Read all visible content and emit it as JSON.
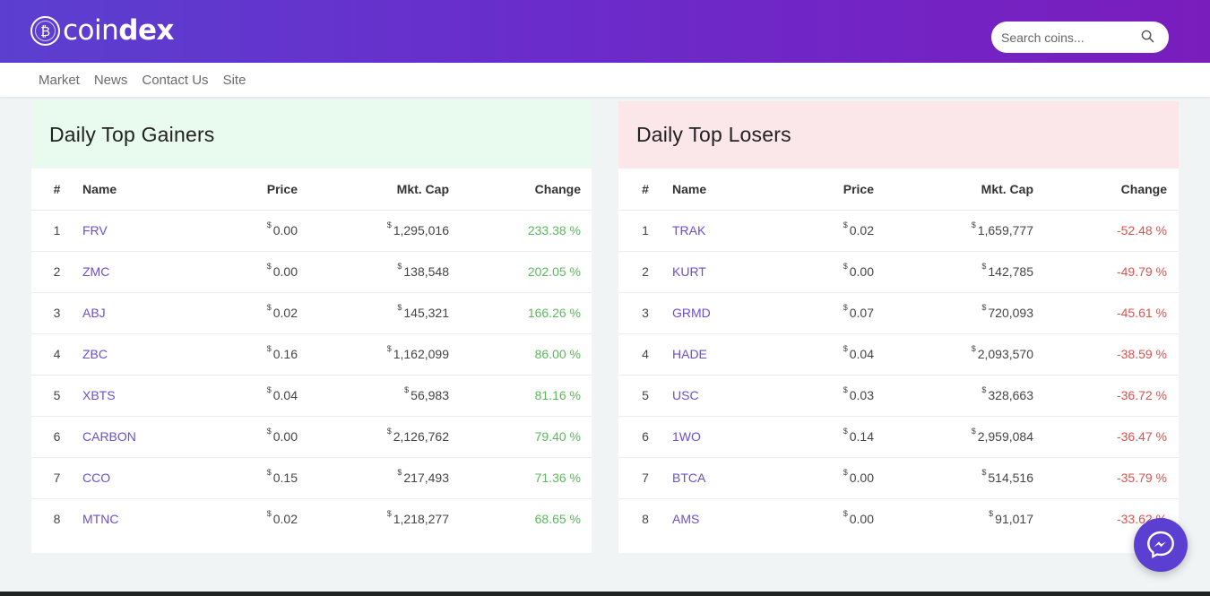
{
  "brand": {
    "name_prefix": "coin",
    "name_suffix": "dex",
    "badge_symbol": "₿"
  },
  "search": {
    "placeholder": "Search coins..."
  },
  "nav": {
    "items": [
      "Market",
      "News",
      "Contact Us",
      "Site"
    ]
  },
  "currency_symbol": "$",
  "colors": {
    "header_start": "#5b3fd0",
    "header_end": "#7a1dbd",
    "coin_link": "#6a4fd1",
    "gain": "#5cb85c",
    "loss": "#d9534f"
  },
  "gainers": {
    "title": "Daily Top Gainers",
    "columns": {
      "rank": "#",
      "name": "Name",
      "price": "Price",
      "mcap": "Mkt. Cap",
      "change": "Change"
    },
    "rows": [
      {
        "rank": "1",
        "name": "FRV",
        "price": "0.00",
        "mcap": "1,295,016",
        "change": "233.38 %"
      },
      {
        "rank": "2",
        "name": "ZMC",
        "price": "0.00",
        "mcap": "138,548",
        "change": "202.05 %"
      },
      {
        "rank": "3",
        "name": "ABJ",
        "price": "0.02",
        "mcap": "145,321",
        "change": "166.26 %"
      },
      {
        "rank": "4",
        "name": "ZBC",
        "price": "0.16",
        "mcap": "1,162,099",
        "change": "86.00 %"
      },
      {
        "rank": "5",
        "name": "XBTS",
        "price": "0.04",
        "mcap": "56,983",
        "change": "81.16 %"
      },
      {
        "rank": "6",
        "name": "CARBON",
        "price": "0.00",
        "mcap": "2,126,762",
        "change": "79.40 %"
      },
      {
        "rank": "7",
        "name": "CCO",
        "price": "0.15",
        "mcap": "217,493",
        "change": "71.36 %"
      },
      {
        "rank": "8",
        "name": "MTNC",
        "price": "0.02",
        "mcap": "1,218,277",
        "change": "68.65 %"
      }
    ]
  },
  "losers": {
    "title": "Daily Top Losers",
    "columns": {
      "rank": "#",
      "name": "Name",
      "price": "Price",
      "mcap": "Mkt. Cap",
      "change": "Change"
    },
    "rows": [
      {
        "rank": "1",
        "name": "TRAK",
        "price": "0.02",
        "mcap": "1,659,777",
        "change": "-52.48 %"
      },
      {
        "rank": "2",
        "name": "KURT",
        "price": "0.00",
        "mcap": "142,785",
        "change": "-49.79 %"
      },
      {
        "rank": "3",
        "name": "GRMD",
        "price": "0.07",
        "mcap": "720,093",
        "change": "-45.61 %"
      },
      {
        "rank": "4",
        "name": "HADE",
        "price": "0.04",
        "mcap": "2,093,570",
        "change": "-38.59 %"
      },
      {
        "rank": "5",
        "name": "USC",
        "price": "0.03",
        "mcap": "328,663",
        "change": "-36.72 %"
      },
      {
        "rank": "6",
        "name": "1WO",
        "price": "0.14",
        "mcap": "2,959,084",
        "change": "-36.47 %"
      },
      {
        "rank": "7",
        "name": "BTCA",
        "price": "0.00",
        "mcap": "514,516",
        "change": "-35.79 %"
      },
      {
        "rank": "8",
        "name": "AMS",
        "price": "0.00",
        "mcap": "91,017",
        "change": "-33.62 %"
      }
    ]
  },
  "icons": {
    "search": "search-icon",
    "messenger": "messenger-icon",
    "logo": "bitcoin-logo-icon"
  }
}
